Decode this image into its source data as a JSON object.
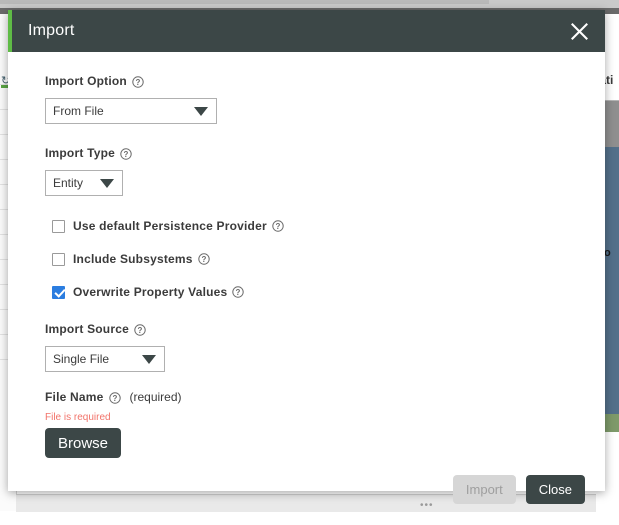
{
  "background": {
    "right_header_fragment": "lati",
    "right_text_fragment_1": "rto",
    "right_text_fragment_2": "o",
    "refresh_icon": "refresh-icon",
    "bottom_dots": "•••"
  },
  "modal": {
    "title": "Import",
    "accent_color": "#5fbb46",
    "header_color": "#3c4747",
    "close_icon": "close-icon",
    "fields": {
      "import_option": {
        "label": "Import Option",
        "help_icon": "help-circle-icon",
        "value": "From File",
        "caret_icon": "caret-down-icon"
      },
      "import_type": {
        "label": "Import Type",
        "help_icon": "help-circle-icon",
        "value": "Entity",
        "caret_icon": "caret-down-icon"
      },
      "import_source": {
        "label": "Import Source",
        "help_icon": "help-circle-icon",
        "value": "Single File",
        "caret_icon": "caret-down-icon"
      },
      "file_name": {
        "label": "File Name",
        "help_icon": "help-circle-icon",
        "required_note": "(required)",
        "error": "File is required",
        "browse_label": "Browse"
      }
    },
    "checkboxes": [
      {
        "label": "Use default Persistence Provider",
        "checked": false,
        "help_icon": "help-circle-icon"
      },
      {
        "label": "Include Subsystems",
        "checked": false,
        "help_icon": "help-circle-icon"
      },
      {
        "label": "Overwrite Property Values",
        "checked": true,
        "help_icon": "help-circle-icon"
      }
    ],
    "footer": {
      "import_label": "Import",
      "import_disabled": true,
      "close_label": "Close"
    },
    "colors": {
      "checkbox_checked": "#2b7de0",
      "error_text": "#f2736a",
      "primary_button": "#3c4747",
      "disabled_button": "#d6d6d6"
    }
  }
}
